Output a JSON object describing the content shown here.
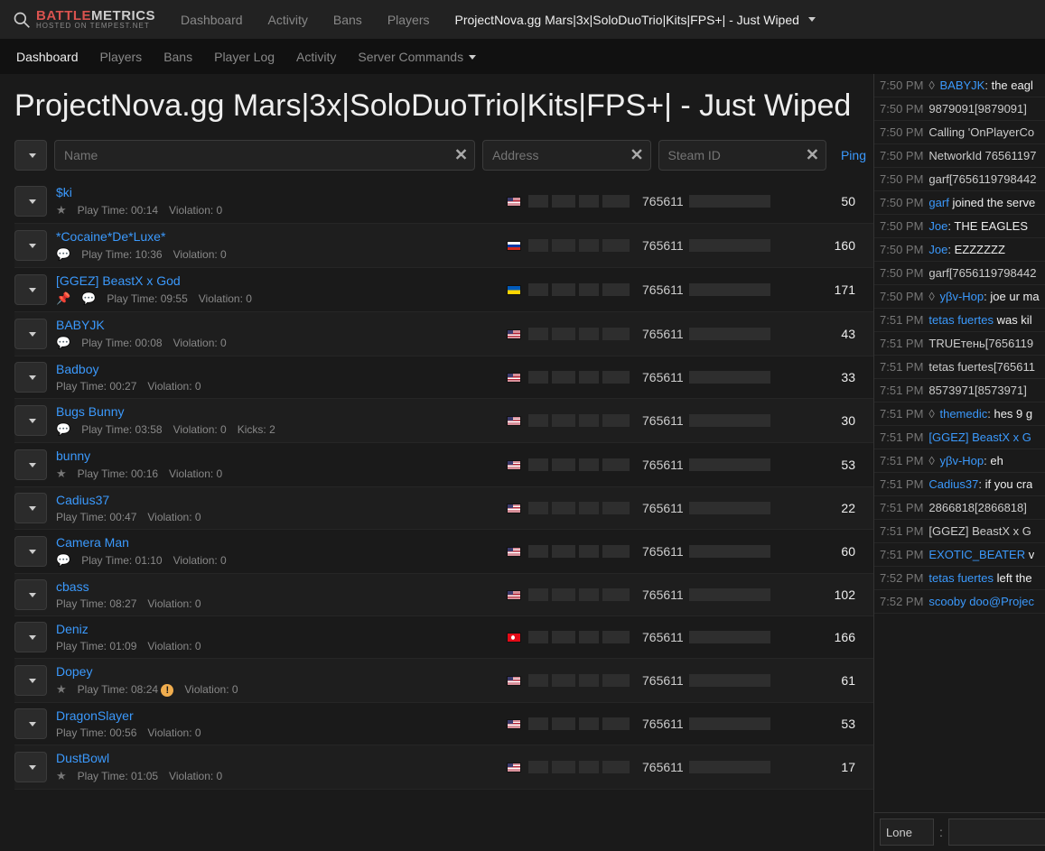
{
  "brand": {
    "part1": "BATTLE",
    "part2": "METRICS",
    "subtitle": "HOSTED ON TEMPEST.NET"
  },
  "topnav": {
    "items": [
      "Dashboard",
      "Activity",
      "Bans",
      "Players"
    ],
    "server": "ProjectNova.gg Mars|3x|SoloDuoTrio|Kits|FPS+| - Just Wiped"
  },
  "subnav": [
    "Dashboard",
    "Players",
    "Bans",
    "Player Log",
    "Activity",
    "Server Commands"
  ],
  "page_title": "ProjectNova.gg Mars|3x|SoloDuoTrio|Kits|FPS+| - Just Wiped",
  "filters": {
    "name_ph": "Name",
    "addr_ph": "Address",
    "steam_ph": "Steam ID",
    "ping": "Ping"
  },
  "players": [
    {
      "name": "$ki",
      "play": "00:14",
      "viol": "0",
      "flag": "us",
      "steam": "765611",
      "ping": "50",
      "star": true,
      "chat": false,
      "pin": false
    },
    {
      "name": "*Cocaine*De*Luxe*",
      "play": "10:36",
      "viol": "0",
      "flag": "ru",
      "steam": "765611",
      "ping": "160",
      "star": false,
      "chat": true,
      "pin": false
    },
    {
      "name": "[GGEZ] BeastX x God",
      "play": "09:55",
      "viol": "0",
      "flag": "ua",
      "steam": "765611",
      "ping": "171",
      "star": false,
      "chat": true,
      "pin": true
    },
    {
      "name": "BABYJK",
      "play": "00:08",
      "viol": "0",
      "flag": "us",
      "steam": "765611",
      "ping": "43",
      "star": false,
      "chat": true,
      "pin": false
    },
    {
      "name": "Badboy",
      "play": "00:27",
      "viol": "0",
      "flag": "us",
      "steam": "765611",
      "ping": "33",
      "star": false,
      "chat": false,
      "pin": false
    },
    {
      "name": "Bugs Bunny",
      "play": "03:58",
      "viol": "0",
      "flag": "us",
      "steam": "765611",
      "ping": "30",
      "star": false,
      "chat": true,
      "pin": false,
      "kicks": "2"
    },
    {
      "name": "bunny",
      "play": "00:16",
      "viol": "0",
      "flag": "us",
      "steam": "765611",
      "ping": "53",
      "star": true,
      "chat": false,
      "pin": false
    },
    {
      "name": "Cadius37",
      "play": "00:47",
      "viol": "0",
      "flag": "us",
      "steam": "765611",
      "ping": "22",
      "star": false,
      "chat": false,
      "pin": false
    },
    {
      "name": "Camera Man",
      "play": "01:10",
      "viol": "0",
      "flag": "us",
      "steam": "765611",
      "ping": "60",
      "star": false,
      "chat": true,
      "pin": false
    },
    {
      "name": "cbass",
      "play": "08:27",
      "viol": "0",
      "flag": "us",
      "steam": "765611",
      "ping": "102",
      "star": false,
      "chat": false,
      "pin": false
    },
    {
      "name": "Deniz",
      "play": "01:09",
      "viol": "0",
      "flag": "tr",
      "steam": "765611",
      "ping": "166",
      "star": false,
      "chat": false,
      "pin": false
    },
    {
      "name": "Dopey",
      "play": "08:24",
      "viol": "0",
      "flag": "us",
      "steam": "765611",
      "ping": "61",
      "star": true,
      "chat": false,
      "pin": false,
      "warn": true
    },
    {
      "name": "DragonSlayer",
      "play": "00:56",
      "viol": "0",
      "flag": "us",
      "steam": "765611",
      "ping": "53",
      "star": false,
      "chat": false,
      "pin": false
    },
    {
      "name": "DustBowl",
      "play": "01:05",
      "viol": "0",
      "flag": "us",
      "steam": "765611",
      "ping": "17",
      "star": true,
      "chat": false,
      "pin": false
    }
  ],
  "meta_labels": {
    "play": "Play Time: ",
    "viol": "Violation: ",
    "kicks": "Kicks: "
  },
  "chat": [
    {
      "t": "7:50 PM",
      "diamond": true,
      "nick": "BABYJK",
      "sep": ": ",
      "msg": "the eagl"
    },
    {
      "t": "7:50 PM",
      "sys": "9879091[9879091] "
    },
    {
      "t": "7:50 PM",
      "sys": "Calling 'OnPlayerCo"
    },
    {
      "t": "7:50 PM",
      "sys": "NetworkId 76561197"
    },
    {
      "t": "7:50 PM",
      "sys": "garf[7656119798442"
    },
    {
      "t": "7:50 PM",
      "nick": "garf",
      "msg": " joined the serve"
    },
    {
      "t": "7:50 PM",
      "nick": "Joe",
      "sep": ": ",
      "msg": "THE EAGLES "
    },
    {
      "t": "7:50 PM",
      "nick": "Joe",
      "sep": ": ",
      "msg": "EZZZZZZ"
    },
    {
      "t": "7:50 PM",
      "sys": "garf[7656119798442"
    },
    {
      "t": "7:50 PM",
      "diamond": true,
      "nick": "yβv-Hop",
      "sep": ": ",
      "msg": "joe ur ma"
    },
    {
      "t": "7:51 PM",
      "nick": "tetas fuertes",
      "msg": " was kil"
    },
    {
      "t": "7:51 PM",
      "sys": "TRUEтень[7656119"
    },
    {
      "t": "7:51 PM",
      "sys": "tetas fuertes[765611"
    },
    {
      "t": "7:51 PM",
      "sys": "8573971[8573971] "
    },
    {
      "t": "7:51 PM",
      "diamond": true,
      "nick": "themedic",
      "sep": ": ",
      "msg": "hes 9 g"
    },
    {
      "t": "7:51 PM",
      "nick": "[GGEZ] BeastX x G"
    },
    {
      "t": "7:51 PM",
      "diamond": true,
      "nick": "yβv-Hop",
      "sep": ": ",
      "msg": "eh"
    },
    {
      "t": "7:51 PM",
      "nick": "Cadius37",
      "sep": ": ",
      "msg": "if you cra"
    },
    {
      "t": "7:51 PM",
      "sys": "2866818[2866818] "
    },
    {
      "t": "7:51 PM",
      "sys": "[GGEZ] BeastX x G"
    },
    {
      "t": "7:51 PM",
      "nick": "EXOTIC_BEATER",
      "msg": " v"
    },
    {
      "t": "7:52 PM",
      "nick": "tetas fuertes",
      "msg": " left the"
    },
    {
      "t": "7:52 PM",
      "nick": "scooby doo@Projec"
    }
  ],
  "chat_input": {
    "select": "Lone",
    "sep": ":"
  }
}
